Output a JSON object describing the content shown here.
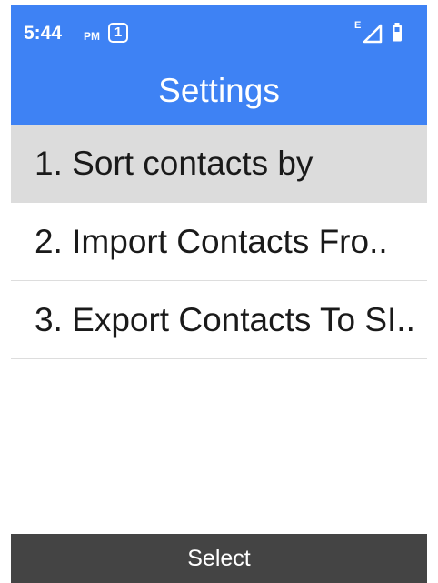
{
  "status_bar": {
    "time": "5:44",
    "ampm": "PM",
    "sim_slot": "1",
    "network_type": "E",
    "signal_icon": "signal-icon",
    "battery_icon": "battery-icon"
  },
  "header": {
    "title": "Settings",
    "color": "#3e82f4"
  },
  "menu": {
    "items": [
      {
        "label": "1. Sort contacts by",
        "selected": true
      },
      {
        "label": "2. Import Contacts Fro..",
        "selected": false
      },
      {
        "label": "3. Export Contacts To SI..",
        "selected": false
      }
    ]
  },
  "softkeys": {
    "center": "Select"
  }
}
